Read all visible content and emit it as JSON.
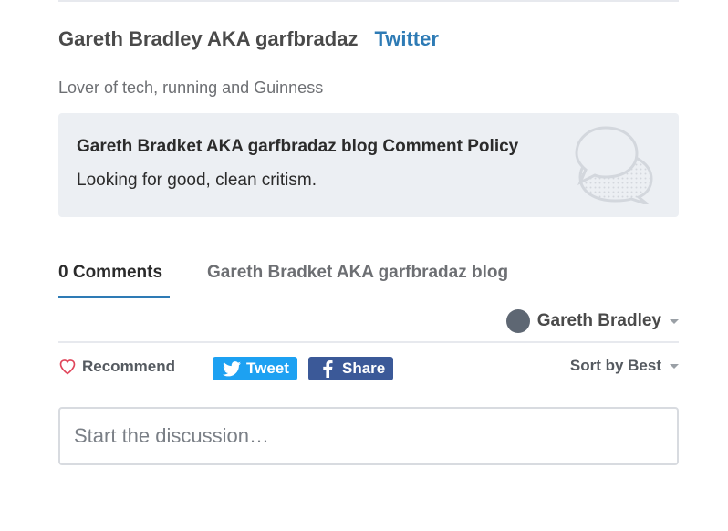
{
  "author": {
    "name": "Gareth Bradley AKA garfbradaz",
    "twitter_label": "Twitter",
    "bio": "Lover of tech, running and Guinness"
  },
  "policy": {
    "title": "Gareth Bradket AKA garfbradaz blog Comment Policy",
    "body": "Looking for good, clean critism.",
    "icon": "speech-bubbles-icon"
  },
  "tabs": [
    {
      "label": "0 Comments",
      "active": true
    },
    {
      "label": "Gareth Bradket AKA garfbradaz blog",
      "active": false
    }
  ],
  "user_menu": {
    "name": "Gareth Bradley",
    "icon": "avatar"
  },
  "actions": {
    "recommend_label": "Recommend",
    "tweet_label": "Tweet",
    "share_label": "Share",
    "sort_label": "Sort by Best"
  },
  "composer": {
    "placeholder": "Start the discussion…",
    "value": ""
  },
  "colors": {
    "accent": "#2e7bb5",
    "twitter": "#1da1f2",
    "facebook": "#3b5998",
    "heart": "#e0455a"
  }
}
